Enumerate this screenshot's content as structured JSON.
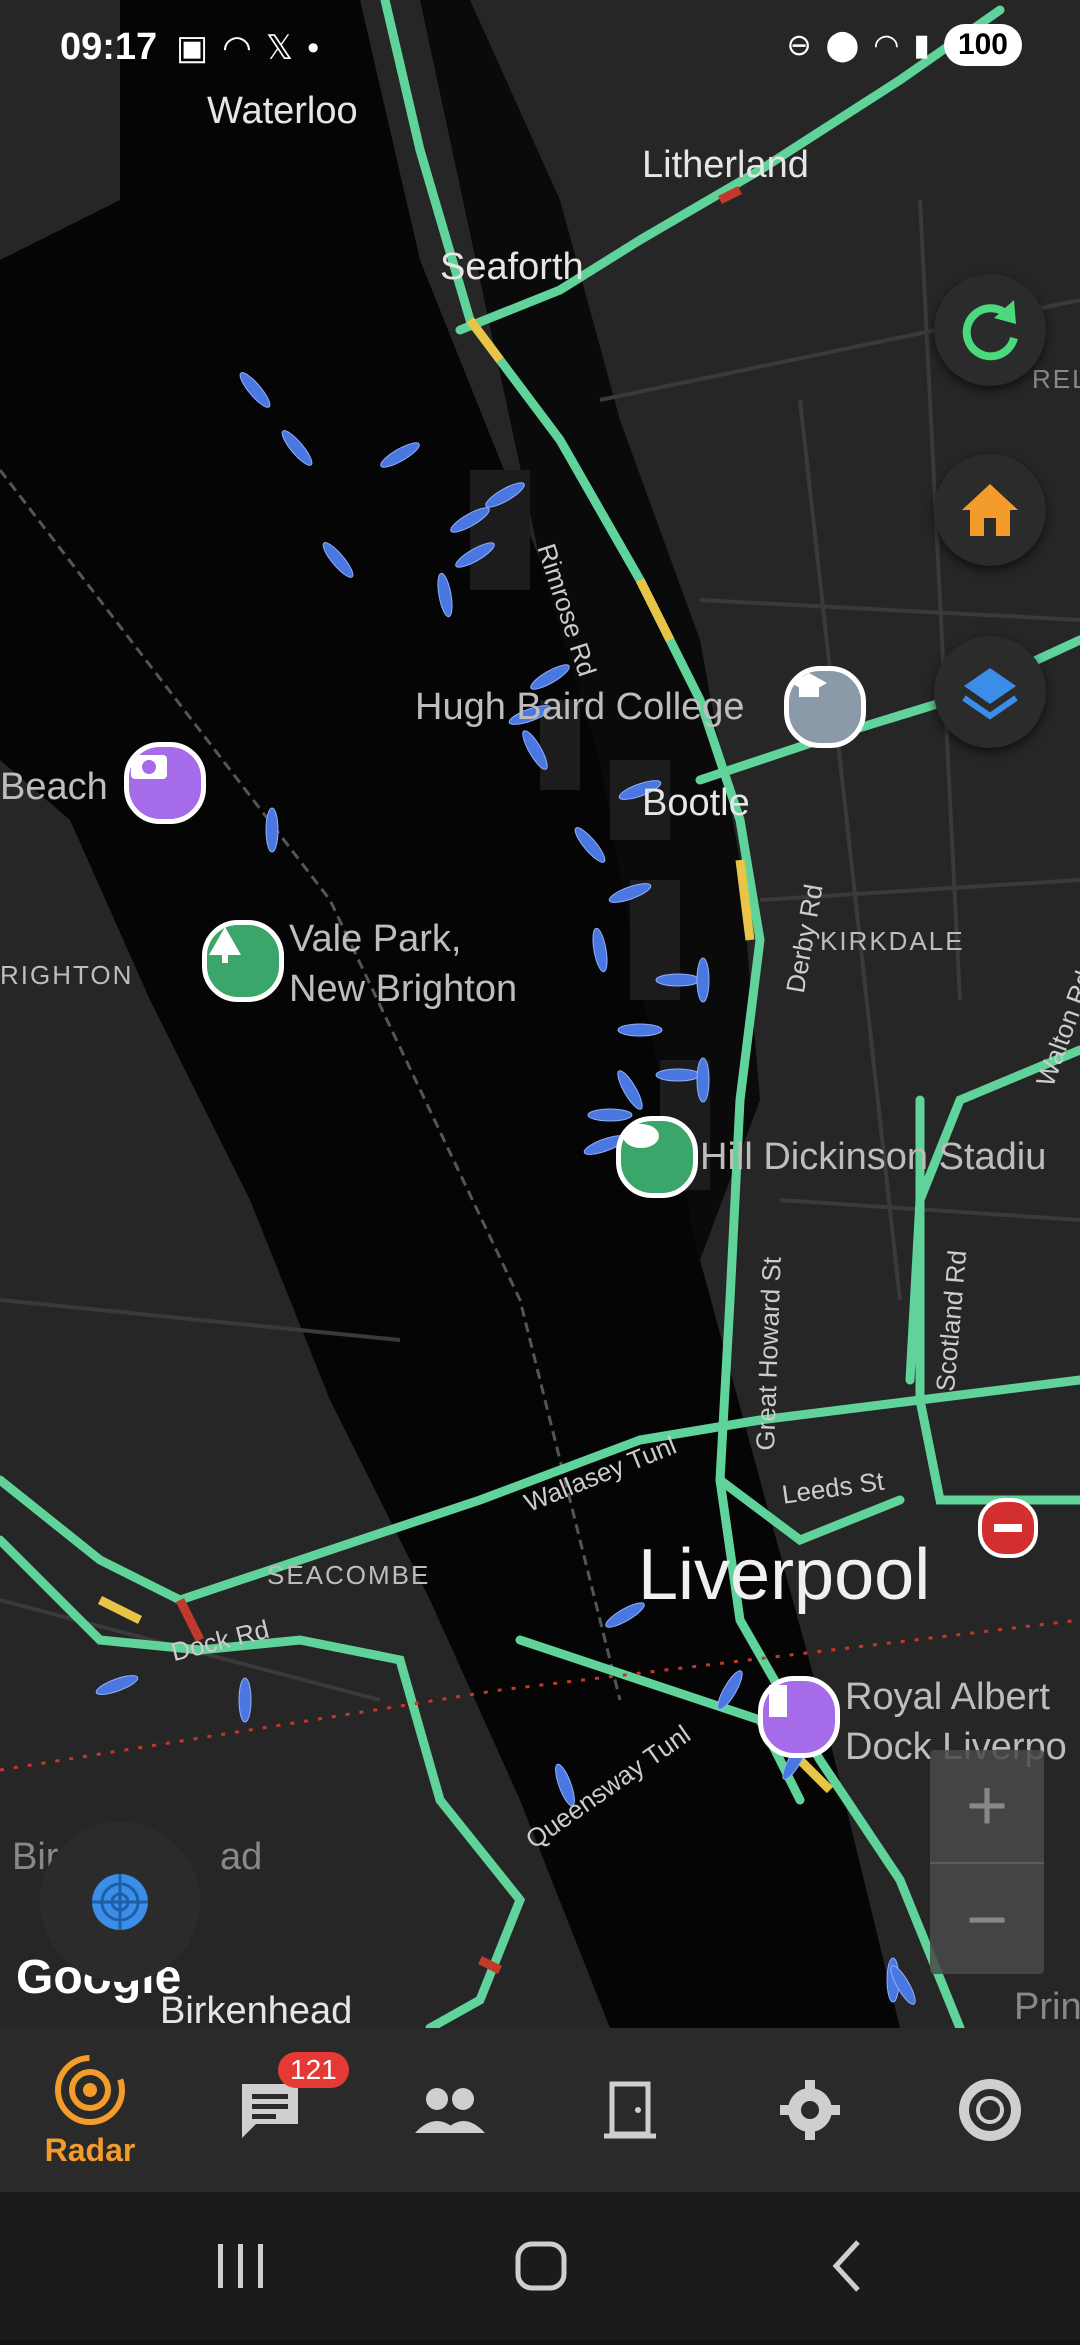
{
  "status_bar": {
    "time": "09:17",
    "left_icons": [
      "screenshot-icon",
      "wifi-icon",
      "x-icon",
      "dot-icon"
    ],
    "right_icons": [
      "dnd-icon",
      "location-icon",
      "wifi-icon",
      "signal-icon"
    ],
    "battery": "100"
  },
  "map": {
    "places": {
      "waterloo": "Waterloo",
      "litherland": "Litherland",
      "seaforth": "Seaforth",
      "hugh_baird": "Hugh Baird College",
      "bootle": "Bootle",
      "beach": "Beach",
      "kirkdale": "KIRKDALE",
      "brighton": "RIGHTON",
      "vale_park": "Vale Park,",
      "vale_park_2": "New Brighton",
      "hill_dickinson": "Hill Dickinson Stadiu",
      "seacombe": "SEACOMBE",
      "liverpool": "Liverpool",
      "royal_albert": "Royal Albert",
      "royal_albert_2": "Dock Liverpo",
      "birkenhead": "Birkenhead",
      "birkenhead_partial": "Bir",
      "prin": "Prin",
      "rel": "REL",
      "ad": "ad"
    },
    "roads": {
      "rimrose": "Rimrose Rd",
      "derby": "Derby Rd",
      "great_howard": "Great Howard St",
      "scotland": "Scotland Rd",
      "walton": "Walton Rd",
      "wallasey_tunl": "Wallasey Tunl",
      "leeds": "Leeds St",
      "dock": "Dock Rd",
      "queensway": "Queensway Tunl"
    },
    "google_logo": "Google"
  },
  "fabs": {
    "refresh": "refresh-icon",
    "home": "home-icon",
    "layers": "layers-icon",
    "radar": "radar-icon"
  },
  "zoom": {
    "in": "+",
    "out": "−"
  },
  "bottom_nav": {
    "active_label": "Radar",
    "messages_badge": "121",
    "items": [
      "radar-icon",
      "chat-icon",
      "people-icon",
      "door-icon",
      "gear-icon",
      "lifebuoy-icon"
    ]
  },
  "colors": {
    "accent": "#f39c2b",
    "road_green": "#5fd39a",
    "road_yellow": "#e8c547",
    "road_red": "#c0392b",
    "ship": "#4a78e0",
    "badge": "#e53935"
  }
}
